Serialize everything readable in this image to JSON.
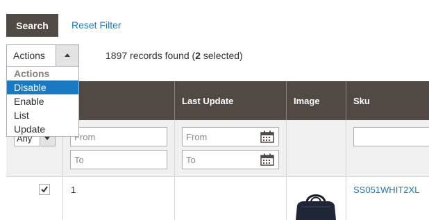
{
  "toolbar": {
    "search_label": "Search",
    "reset_label": "Reset Filter"
  },
  "actions": {
    "selected": "Actions",
    "options": [
      {
        "label": "Actions",
        "type": "group-header"
      },
      {
        "label": "Disable",
        "highlighted": true
      },
      {
        "label": "Enable"
      },
      {
        "label": "List"
      },
      {
        "label": "Update"
      }
    ]
  },
  "records": {
    "prefix": "1897 records found (",
    "selected_count": "2",
    "suffix": " selected)"
  },
  "grid": {
    "columns": [
      "Last Update",
      "Image",
      "Sku"
    ],
    "filters": {
      "status_select": "Any",
      "id_from_placeholder": "From",
      "id_to_placeholder": "To",
      "date_from_placeholder": "From",
      "date_to_placeholder": "To"
    },
    "rows": [
      {
        "checked": true,
        "id": "1",
        "sku": "SS051WHIT2XL"
      }
    ]
  },
  "colors": {
    "header_bg": "#514943",
    "link": "#1979c3",
    "highlight": "#1979c3"
  }
}
